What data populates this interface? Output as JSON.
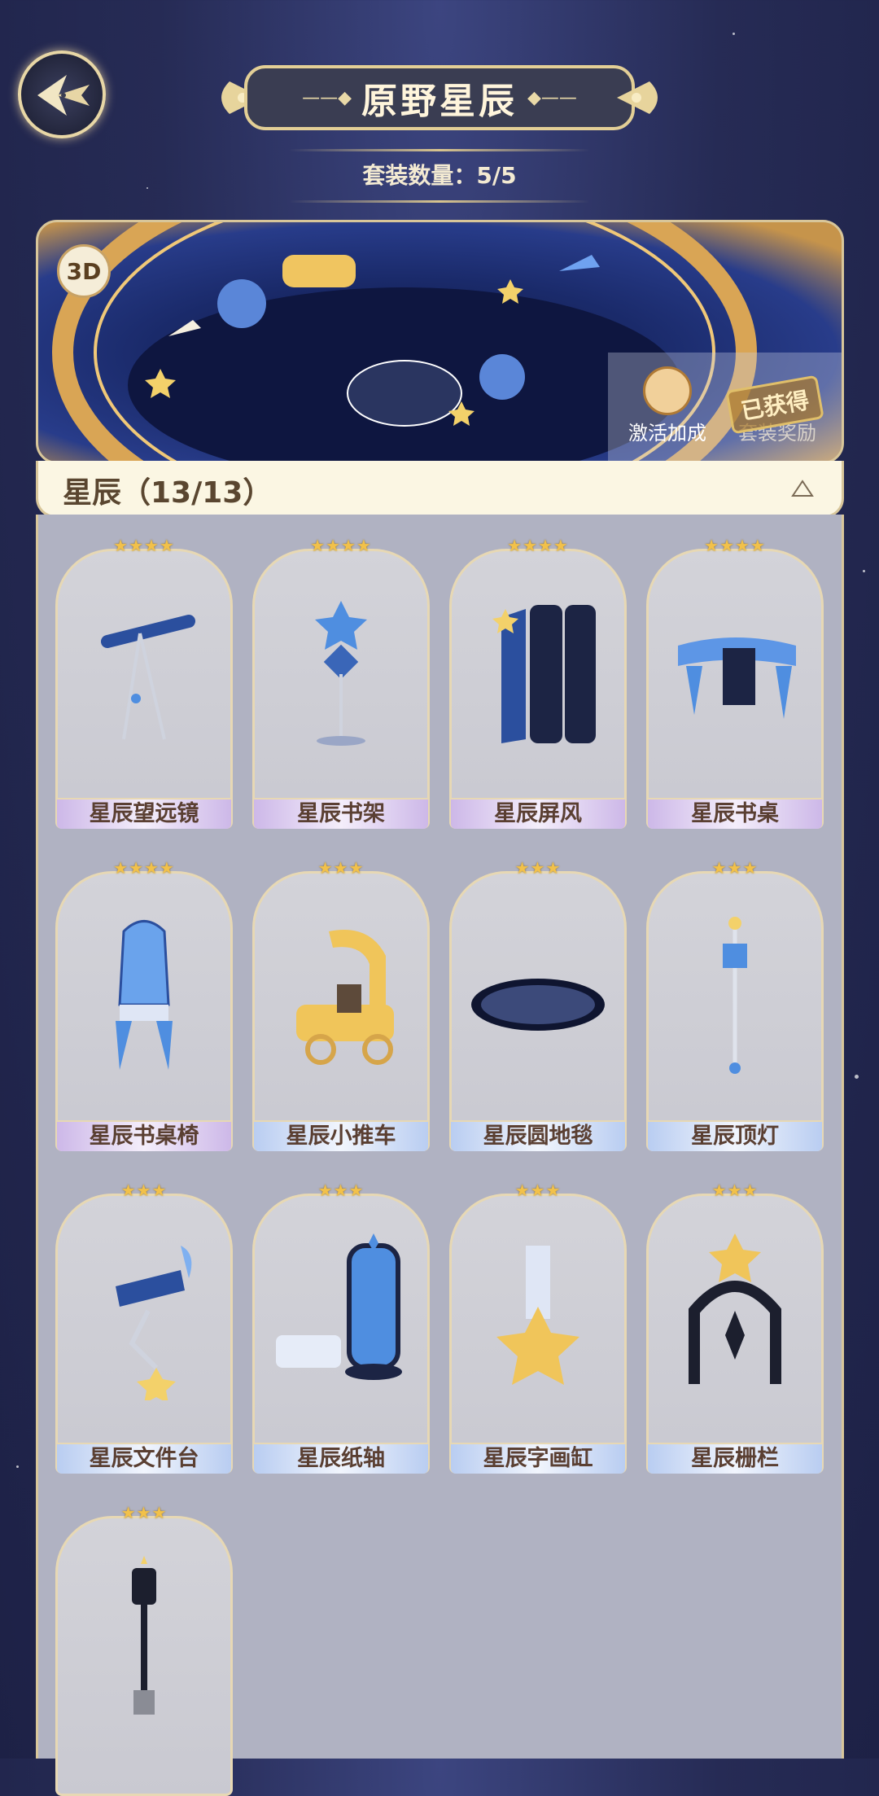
{
  "header": {
    "title": "原野星辰",
    "set_count_label": "套装数量：5/5"
  },
  "banner": {
    "badge_3d": "3D",
    "activate_label": "激活加成",
    "reward_label": "套装奖励",
    "obtained_stamp": "已获得"
  },
  "section": {
    "title": "星辰（13/13）"
  },
  "items": [
    {
      "name": "星辰望远镜",
      "stars": "★★★★",
      "tier": "purple",
      "icon": "telescope-icon"
    },
    {
      "name": "星辰书架",
      "stars": "★★★★",
      "tier": "purple",
      "icon": "bookshelf-icon"
    },
    {
      "name": "星辰屏风",
      "stars": "★★★★",
      "tier": "purple",
      "icon": "screen-icon"
    },
    {
      "name": "星辰书桌",
      "stars": "★★★★",
      "tier": "purple",
      "icon": "desk-icon"
    },
    {
      "name": "星辰书桌椅",
      "stars": "★★★★",
      "tier": "purple",
      "icon": "chair-icon"
    },
    {
      "name": "星辰小推车",
      "stars": "★★★",
      "tier": "blue",
      "icon": "cart-icon"
    },
    {
      "name": "星辰圆地毯",
      "stars": "★★★",
      "tier": "blue",
      "icon": "rug-icon"
    },
    {
      "name": "星辰顶灯",
      "stars": "★★★",
      "tier": "blue",
      "icon": "ceiling-lamp-icon"
    },
    {
      "name": "星辰文件台",
      "stars": "★★★",
      "tier": "blue",
      "icon": "file-stand-icon"
    },
    {
      "name": "星辰纸轴",
      "stars": "★★★",
      "tier": "blue",
      "icon": "scroll-icon"
    },
    {
      "name": "星辰字画缸",
      "stars": "★★★",
      "tier": "blue",
      "icon": "scroll-jar-icon"
    },
    {
      "name": "星辰栅栏",
      "stars": "★★★",
      "tier": "blue",
      "icon": "fence-icon"
    },
    {
      "name": "",
      "stars": "★★★",
      "tier": "blue",
      "icon": "street-lamp-icon"
    }
  ]
}
